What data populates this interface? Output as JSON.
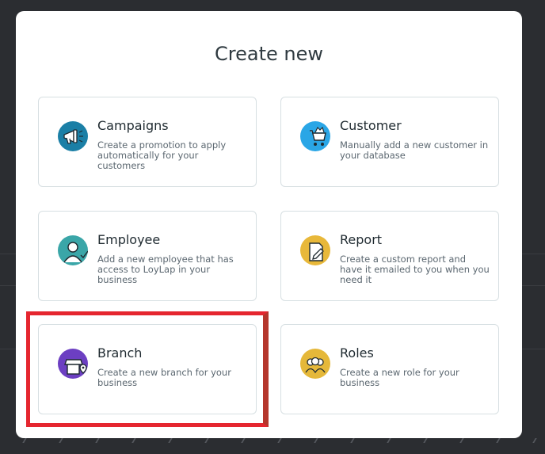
{
  "modal": {
    "title": "Create new",
    "cards": [
      {
        "title": "Campaigns",
        "description": "Create a promotion to apply automatically for your customers",
        "icon": "megaphone-icon",
        "color": "#1b7fa6"
      },
      {
        "title": "Customer",
        "description": "Manually add a new customer in your database",
        "icon": "shopping-cart-icon",
        "color": "#2aa6e6"
      },
      {
        "title": "Employee",
        "description": "Add a new employee that has access to LoyLap in your business",
        "icon": "employee-icon",
        "color": "#3aa6a8"
      },
      {
        "title": "Report",
        "description": "Create a custom report and have it emailed to you when you need it",
        "icon": "report-icon",
        "color": "#e8b83a"
      },
      {
        "title": "Branch",
        "description": "Create a new branch for your business",
        "icon": "store-location-icon",
        "color": "#6c3fc2"
      },
      {
        "title": "Roles",
        "description": "Create a new role for your business",
        "icon": "roles-icon",
        "color": "#e5b83a"
      }
    ]
  },
  "highlight_color": "#e5262f"
}
